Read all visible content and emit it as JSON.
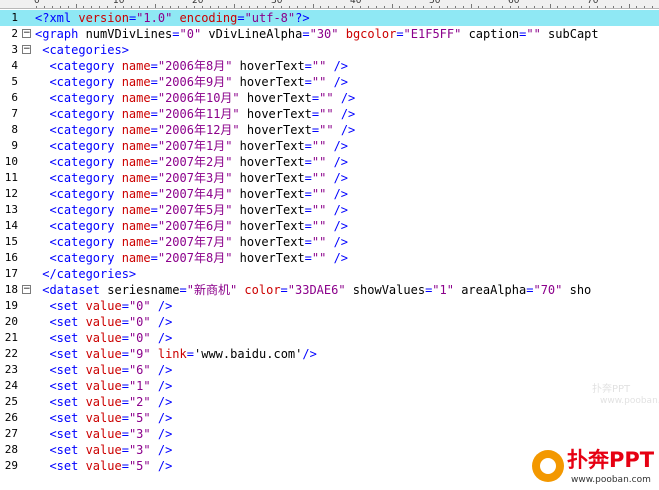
{
  "ruler": {
    "marks": [
      "0",
      "10",
      "20",
      "30",
      "40",
      "50",
      "60",
      "70"
    ]
  },
  "lines": [
    {
      "num": "1",
      "fold": "",
      "current": true,
      "tokens": [
        [
          "tag",
          "<?xml "
        ],
        [
          "attr",
          "version"
        ],
        [
          "tag",
          "="
        ],
        [
          "val",
          "\"1.0\""
        ],
        [
          "tag",
          " "
        ],
        [
          "attr",
          "encoding"
        ],
        [
          "tag",
          "="
        ],
        [
          "val",
          "\"utf-8\""
        ],
        [
          "tag",
          "?>"
        ]
      ]
    },
    {
      "num": "2",
      "fold": "−",
      "current": false,
      "tokens": [
        [
          "tag",
          "<graph "
        ],
        [
          "txt",
          "numVDivLines"
        ],
        [
          "tag",
          "="
        ],
        [
          "val",
          "\"0\""
        ],
        [
          "txt",
          " vDivLineAlpha"
        ],
        [
          "tag",
          "="
        ],
        [
          "val",
          "\"30\""
        ],
        [
          "txt",
          " "
        ],
        [
          "attr",
          "bgcolor"
        ],
        [
          "tag",
          "="
        ],
        [
          "val",
          "\"E1F5FF\""
        ],
        [
          "txt",
          " caption"
        ],
        [
          "tag",
          "="
        ],
        [
          "val",
          "\"\""
        ],
        [
          "txt",
          " subCapt"
        ]
      ]
    },
    {
      "num": "3",
      "fold": "−",
      "current": false,
      "tokens": [
        [
          "tag",
          " <categories>"
        ]
      ]
    },
    {
      "num": "4",
      "fold": "",
      "current": false,
      "tokens": [
        [
          "tag",
          "  <category "
        ],
        [
          "attr",
          "name"
        ],
        [
          "tag",
          "="
        ],
        [
          "val",
          "\"2006年8月\""
        ],
        [
          "txt",
          " hoverText"
        ],
        [
          "tag",
          "="
        ],
        [
          "val",
          "\"\""
        ],
        [
          "tag",
          " />"
        ]
      ]
    },
    {
      "num": "5",
      "fold": "",
      "current": false,
      "tokens": [
        [
          "tag",
          "  <category "
        ],
        [
          "attr",
          "name"
        ],
        [
          "tag",
          "="
        ],
        [
          "val",
          "\"2006年9月\""
        ],
        [
          "txt",
          " hoverText"
        ],
        [
          "tag",
          "="
        ],
        [
          "val",
          "\"\""
        ],
        [
          "tag",
          " />"
        ]
      ]
    },
    {
      "num": "6",
      "fold": "",
      "current": false,
      "tokens": [
        [
          "tag",
          "  <category "
        ],
        [
          "attr",
          "name"
        ],
        [
          "tag",
          "="
        ],
        [
          "val",
          "\"2006年10月\""
        ],
        [
          "txt",
          " hoverText"
        ],
        [
          "tag",
          "="
        ],
        [
          "val",
          "\"\""
        ],
        [
          "tag",
          " />"
        ]
      ]
    },
    {
      "num": "7",
      "fold": "",
      "current": false,
      "tokens": [
        [
          "tag",
          "  <category "
        ],
        [
          "attr",
          "name"
        ],
        [
          "tag",
          "="
        ],
        [
          "val",
          "\"2006年11月\""
        ],
        [
          "txt",
          " hoverText"
        ],
        [
          "tag",
          "="
        ],
        [
          "val",
          "\"\""
        ],
        [
          "tag",
          " />"
        ]
      ]
    },
    {
      "num": "8",
      "fold": "",
      "current": false,
      "tokens": [
        [
          "tag",
          "  <category "
        ],
        [
          "attr",
          "name"
        ],
        [
          "tag",
          "="
        ],
        [
          "val",
          "\"2006年12月\""
        ],
        [
          "txt",
          " hoverText"
        ],
        [
          "tag",
          "="
        ],
        [
          "val",
          "\"\""
        ],
        [
          "tag",
          " />"
        ]
      ]
    },
    {
      "num": "9",
      "fold": "",
      "current": false,
      "tokens": [
        [
          "tag",
          "  <category "
        ],
        [
          "attr",
          "name"
        ],
        [
          "tag",
          "="
        ],
        [
          "val",
          "\"2007年1月\""
        ],
        [
          "txt",
          " hoverText"
        ],
        [
          "tag",
          "="
        ],
        [
          "val",
          "\"\""
        ],
        [
          "tag",
          " />"
        ]
      ]
    },
    {
      "num": "10",
      "fold": "",
      "current": false,
      "tokens": [
        [
          "tag",
          "  <category "
        ],
        [
          "attr",
          "name"
        ],
        [
          "tag",
          "="
        ],
        [
          "val",
          "\"2007年2月\""
        ],
        [
          "txt",
          " hoverText"
        ],
        [
          "tag",
          "="
        ],
        [
          "val",
          "\"\""
        ],
        [
          "tag",
          " />"
        ]
      ]
    },
    {
      "num": "11",
      "fold": "",
      "current": false,
      "tokens": [
        [
          "tag",
          "  <category "
        ],
        [
          "attr",
          "name"
        ],
        [
          "tag",
          "="
        ],
        [
          "val",
          "\"2007年3月\""
        ],
        [
          "txt",
          " hoverText"
        ],
        [
          "tag",
          "="
        ],
        [
          "val",
          "\"\""
        ],
        [
          "tag",
          " />"
        ]
      ]
    },
    {
      "num": "12",
      "fold": "",
      "current": false,
      "tokens": [
        [
          "tag",
          "  <category "
        ],
        [
          "attr",
          "name"
        ],
        [
          "tag",
          "="
        ],
        [
          "val",
          "\"2007年4月\""
        ],
        [
          "txt",
          " hoverText"
        ],
        [
          "tag",
          "="
        ],
        [
          "val",
          "\"\""
        ],
        [
          "tag",
          " />"
        ]
      ]
    },
    {
      "num": "13",
      "fold": "",
      "current": false,
      "tokens": [
        [
          "tag",
          "  <category "
        ],
        [
          "attr",
          "name"
        ],
        [
          "tag",
          "="
        ],
        [
          "val",
          "\"2007年5月\""
        ],
        [
          "txt",
          " hoverText"
        ],
        [
          "tag",
          "="
        ],
        [
          "val",
          "\"\""
        ],
        [
          "tag",
          " />"
        ]
      ]
    },
    {
      "num": "14",
      "fold": "",
      "current": false,
      "tokens": [
        [
          "tag",
          "  <category "
        ],
        [
          "attr",
          "name"
        ],
        [
          "tag",
          "="
        ],
        [
          "val",
          "\"2007年6月\""
        ],
        [
          "txt",
          " hoverText"
        ],
        [
          "tag",
          "="
        ],
        [
          "val",
          "\"\""
        ],
        [
          "tag",
          " />"
        ]
      ]
    },
    {
      "num": "15",
      "fold": "",
      "current": false,
      "tokens": [
        [
          "tag",
          "  <category "
        ],
        [
          "attr",
          "name"
        ],
        [
          "tag",
          "="
        ],
        [
          "val",
          "\"2007年7月\""
        ],
        [
          "txt",
          " hoverText"
        ],
        [
          "tag",
          "="
        ],
        [
          "val",
          "\"\""
        ],
        [
          "tag",
          " />"
        ]
      ]
    },
    {
      "num": "16",
      "fold": "",
      "current": false,
      "tokens": [
        [
          "tag",
          "  <category "
        ],
        [
          "attr",
          "name"
        ],
        [
          "tag",
          "="
        ],
        [
          "val",
          "\"2007年8月\""
        ],
        [
          "txt",
          " hoverText"
        ],
        [
          "tag",
          "="
        ],
        [
          "val",
          "\"\""
        ],
        [
          "tag",
          " />"
        ]
      ]
    },
    {
      "num": "17",
      "fold": "",
      "current": false,
      "tokens": [
        [
          "tag",
          " </categories>"
        ]
      ]
    },
    {
      "num": "18",
      "fold": "−",
      "current": false,
      "tokens": [
        [
          "tag",
          " <dataset "
        ],
        [
          "txt",
          "seriesname"
        ],
        [
          "tag",
          "="
        ],
        [
          "val",
          "\"新商机\""
        ],
        [
          "txt",
          " "
        ],
        [
          "attr",
          "color"
        ],
        [
          "tag",
          "="
        ],
        [
          "val",
          "\"33DAE6\""
        ],
        [
          "txt",
          " showValues"
        ],
        [
          "tag",
          "="
        ],
        [
          "val",
          "\"1\""
        ],
        [
          "txt",
          " areaAlpha"
        ],
        [
          "tag",
          "="
        ],
        [
          "val",
          "\"70\""
        ],
        [
          "txt",
          " sho"
        ]
      ]
    },
    {
      "num": "19",
      "fold": "",
      "current": false,
      "tokens": [
        [
          "tag",
          "  <set "
        ],
        [
          "attr",
          "value"
        ],
        [
          "tag",
          "="
        ],
        [
          "val",
          "\"0\""
        ],
        [
          "tag",
          " />"
        ]
      ]
    },
    {
      "num": "20",
      "fold": "",
      "current": false,
      "tokens": [
        [
          "tag",
          "  <set "
        ],
        [
          "attr",
          "value"
        ],
        [
          "tag",
          "="
        ],
        [
          "val",
          "\"0\""
        ],
        [
          "tag",
          " />"
        ]
      ]
    },
    {
      "num": "21",
      "fold": "",
      "current": false,
      "tokens": [
        [
          "tag",
          "  <set "
        ],
        [
          "attr",
          "value"
        ],
        [
          "tag",
          "="
        ],
        [
          "val",
          "\"0\""
        ],
        [
          "tag",
          " />"
        ]
      ]
    },
    {
      "num": "22",
      "fold": "",
      "current": false,
      "tokens": [
        [
          "tag",
          "  <set "
        ],
        [
          "attr",
          "value"
        ],
        [
          "tag",
          "="
        ],
        [
          "val",
          "\"9\""
        ],
        [
          "txt",
          " "
        ],
        [
          "attr",
          "link"
        ],
        [
          "tag",
          "="
        ],
        [
          "txt",
          "'www.baidu.com'"
        ],
        [
          "tag",
          "/>"
        ]
      ]
    },
    {
      "num": "23",
      "fold": "",
      "current": false,
      "tokens": [
        [
          "tag",
          "  <set "
        ],
        [
          "attr",
          "value"
        ],
        [
          "tag",
          "="
        ],
        [
          "val",
          "\"6\""
        ],
        [
          "tag",
          " />"
        ]
      ]
    },
    {
      "num": "24",
      "fold": "",
      "current": false,
      "tokens": [
        [
          "tag",
          "  <set "
        ],
        [
          "attr",
          "value"
        ],
        [
          "tag",
          "="
        ],
        [
          "val",
          "\"1\""
        ],
        [
          "tag",
          " />"
        ]
      ]
    },
    {
      "num": "25",
      "fold": "",
      "current": false,
      "tokens": [
        [
          "tag",
          "  <set "
        ],
        [
          "attr",
          "value"
        ],
        [
          "tag",
          "="
        ],
        [
          "val",
          "\"2\""
        ],
        [
          "tag",
          " />"
        ]
      ]
    },
    {
      "num": "26",
      "fold": "",
      "current": false,
      "tokens": [
        [
          "tag",
          "  <set "
        ],
        [
          "attr",
          "value"
        ],
        [
          "tag",
          "="
        ],
        [
          "val",
          "\"5\""
        ],
        [
          "tag",
          " />"
        ]
      ]
    },
    {
      "num": "27",
      "fold": "",
      "current": false,
      "tokens": [
        [
          "tag",
          "  <set "
        ],
        [
          "attr",
          "value"
        ],
        [
          "tag",
          "="
        ],
        [
          "val",
          "\"3\""
        ],
        [
          "tag",
          " />"
        ]
      ]
    },
    {
      "num": "28",
      "fold": "",
      "current": false,
      "tokens": [
        [
          "tag",
          "  <set "
        ],
        [
          "attr",
          "value"
        ],
        [
          "tag",
          "="
        ],
        [
          "val",
          "\"3\""
        ],
        [
          "tag",
          " />"
        ]
      ]
    },
    {
      "num": "29",
      "fold": "",
      "current": false,
      "tokens": [
        [
          "tag",
          "  <set "
        ],
        [
          "attr",
          "value"
        ],
        [
          "tag",
          "="
        ],
        [
          "val",
          "\"5\""
        ],
        [
          "tag",
          " />"
        ]
      ]
    }
  ],
  "logo": {
    "brand": "扑奔PPT",
    "url": "www.pooban.com"
  },
  "watermark": {
    "line1": "扑奔PPT",
    "line2": "www.pooban.com"
  },
  "colors": {
    "tag": "#0000ff",
    "attr": "#cc0000",
    "val": "#8b008b",
    "current_line": "#8fe8f4",
    "logo_orange": "#f39800",
    "logo_red": "#e60012"
  }
}
